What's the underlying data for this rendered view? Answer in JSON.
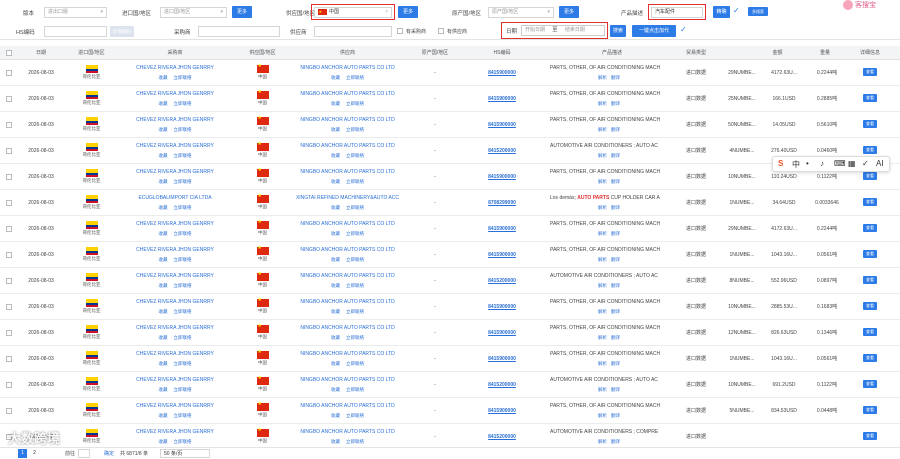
{
  "filters": {
    "version_label": "版本",
    "version_value": "进出口版",
    "import_country_label": "进口国/地区",
    "import_country_placeholder": "进口国/地区",
    "more_label": "更多",
    "supplier_country_label": "供应国/地区",
    "supplier_country_value": "中国",
    "origin_country_label": "原产国/地区",
    "origin_country_placeholder": "原产国/地区",
    "product_desc_label": "产品描述",
    "product_desc_value": "汽车配件",
    "precise_label": "精确",
    "multi_label": "多搜索",
    "hs_label": "HS编码",
    "hs_btn": "新增编码",
    "buyer_label": "采购商",
    "supplier_label": "供应商",
    "has_buyer_label": "有采购商",
    "has_supplier_label": "有供应商",
    "date_label": "日期",
    "start_date": "开始日期",
    "date_sep": "至",
    "end_date": "结束日期",
    "search_btn": "搜索",
    "search_all_btn": "一键点击加代",
    "logo_text": "客搜宝"
  },
  "columns": [
    "日期",
    "进口国/地区",
    "采购商",
    "供应国/地区",
    "供应商",
    "原产国/地区",
    "HS编码",
    "产品描述",
    "贸易类型",
    "金额",
    "重量",
    "详细信息"
  ],
  "rows": [
    {
      "date": "2026-08-03",
      "importer_country": "哥伦比亚",
      "buyer": "CHEVEZ RIVERA JHON GENRRY",
      "supplier_country": "中国",
      "supplier": "NINGBO ANCHOR AUTO PARTS CO LTD",
      "origin": "-",
      "hs": "8415900000",
      "desc": "PARTS, OTHER, OF AIR CONDITIONING MACH",
      "trade": "进口数据",
      "qty": "29NUMBE...",
      "amount": "4172.63U...",
      "weight": "0.2244吨"
    },
    {
      "date": "2026-08-03",
      "importer_country": "哥伦比亚",
      "buyer": "CHEVEZ RIVERA JHON GENRRY",
      "supplier_country": "中国",
      "supplier": "NINGBO ANCHOR AUTO PARTS CO LTD",
      "origin": "-",
      "hs": "8415900000",
      "desc": "PARTS, OTHER, OF AIR CONDITIONING MACH",
      "trade": "进口数据",
      "qty": "25NUMBE...",
      "amount": "166.1USD",
      "weight": "0.2885吨"
    },
    {
      "date": "2026-08-03",
      "importer_country": "哥伦比亚",
      "buyer": "CHEVEZ RIVERA JHON GENRRY",
      "supplier_country": "中国",
      "supplier": "NINGBO ANCHOR AUTO PARTS CO LTD",
      "origin": "-",
      "hs": "8415900000",
      "desc": "PARTS, OTHER, OF AIR CONDITIONING MACH",
      "trade": "进口数据",
      "qty": "50NUMBE...",
      "amount": "14.05USD",
      "weight": "0.5610吨"
    },
    {
      "date": "2026-08-03",
      "importer_country": "哥伦比亚",
      "buyer": "CHEVEZ RIVERA JHON GENRRY",
      "supplier_country": "中国",
      "supplier": "NINGBO ANCHOR AUTO PARTS CO LTD",
      "origin": "-",
      "hs": "8415200000",
      "desc": "AUTOMOTIVE AIR CONDITIONERS ; AUTO AC",
      "trade": "进口数据",
      "qty": "4NUMBE...",
      "amount": "276.40USD",
      "weight": "0.0460吨"
    },
    {
      "date": "2026-08-03",
      "importer_country": "哥伦比亚",
      "buyer": "CHEVEZ RIVERA JHON GENRRY",
      "supplier_country": "中国",
      "supplier": "NINGBO ANCHOR AUTO PARTS CO LTD",
      "origin": "-",
      "hs": "8415900000",
      "desc": "PARTS, OTHER, OF AIR CONDITIONING MACH",
      "trade": "进口数据",
      "qty": "10NUMBE...",
      "amount": "110.24USD",
      "weight": "0.1122吨"
    },
    {
      "date": "2026-08-03",
      "importer_country": "哥伦比亚",
      "buyer": "ECUGLOBALIMPORT CIA LTDA",
      "supplier_country": "中国",
      "supplier": "XINGTAI REFINED MACHINERY&AUTO ACC",
      "origin": "-",
      "hs": "8708299090",
      "desc_pre": "Los demás; ",
      "desc_hl": "AUTO PARTS",
      "desc_post": " CUP HOLDER CAR A",
      "trade": "进口数据",
      "qty": "1NUMBE...",
      "amount": "34.64USD",
      "weight": "0.0033646"
    },
    {
      "date": "2026-08-03",
      "importer_country": "哥伦比亚",
      "buyer": "CHEVEZ RIVERA JHON GENRRY",
      "supplier_country": "中国",
      "supplier": "NINGBO ANCHOR AUTO PARTS CO LTD",
      "origin": "-",
      "hs": "8415900000",
      "desc": "PARTS, OTHER, OF AIR CONDITIONING MACH",
      "trade": "进口数据",
      "qty": "29NUMBE...",
      "amount": "4172.63U...",
      "weight": "0.2244吨"
    },
    {
      "date": "2026-08-03",
      "importer_country": "哥伦比亚",
      "buyer": "CHEVEZ RIVERA JHON GENRRY",
      "supplier_country": "中国",
      "supplier": "NINGBO ANCHOR AUTO PARTS CO LTD",
      "origin": "-",
      "hs": "8415900000",
      "desc": "PARTS, OTHER, OF AIR CONDITIONING MACH",
      "trade": "进口数据",
      "qty": "1NUMBE...",
      "amount": "1043.16U...",
      "weight": "0.0561吨"
    },
    {
      "date": "2026-08-03",
      "importer_country": "哥伦比亚",
      "buyer": "CHEVEZ RIVERA JHON GENRRY",
      "supplier_country": "中国",
      "supplier": "NINGBO ANCHOR AUTO PARTS CO LTD",
      "origin": "-",
      "hs": "8415200000",
      "desc": "AUTOMOTIVE AIR CONDITIONERS ; AUTO AC",
      "trade": "进口数据",
      "qty": "8NUMBE...",
      "amount": "552.96USD",
      "weight": "0.0897吨"
    },
    {
      "date": "2026-08-03",
      "importer_country": "哥伦比亚",
      "buyer": "CHEVEZ RIVERA JHON GENRRY",
      "supplier_country": "中国",
      "supplier": "NINGBO ANCHOR AUTO PARTS CO LTD",
      "origin": "-",
      "hs": "8415900000",
      "desc": "PARTS, OTHER, OF AIR CONDITIONING MACH",
      "trade": "进口数据",
      "qty": "10NUMBE...",
      "amount": "2885.53U...",
      "weight": "0.1683吨"
    },
    {
      "date": "2026-08-03",
      "importer_country": "哥伦比亚",
      "buyer": "CHEVEZ RIVERA JHON GENRRY",
      "supplier_country": "中国",
      "supplier": "NINGBO ANCHOR AUTO PARTS CO LTD",
      "origin": "-",
      "hs": "8415900000",
      "desc": "PARTS, OTHER, OF AIR CONDITIONING MACH",
      "trade": "进口数据",
      "qty": "12NUMBE...",
      "amount": "826.63USD",
      "weight": "0.1346吨"
    },
    {
      "date": "2026-08-03",
      "importer_country": "哥伦比亚",
      "buyer": "CHEVEZ RIVERA JHON GENRRY",
      "supplier_country": "中国",
      "supplier": "NINGBO ANCHOR AUTO PARTS CO LTD",
      "origin": "-",
      "hs": "8415900000",
      "desc": "PARTS, OTHER, OF AIR CONDITIONING MACH",
      "trade": "进口数据",
      "qty": "1NUMBE...",
      "amount": "1043.16U...",
      "weight": "0.0561吨"
    },
    {
      "date": "2026-08-03",
      "importer_country": "哥伦比亚",
      "buyer": "CHEVEZ RIVERA JHON GENRRY",
      "supplier_country": "中国",
      "supplier": "NINGBO ANCHOR AUTO PARTS CO LTD",
      "origin": "-",
      "hs": "8415200000",
      "desc": "AUTOMOTIVE AIR CONDITIONERS ; AUTO AC",
      "trade": "进口数据",
      "qty": "10NUMBE...",
      "amount": "691.2USD",
      "weight": "0.1122吨"
    },
    {
      "date": "2026-08-03",
      "importer_country": "哥伦比亚",
      "buyer": "CHEVEZ RIVERA JHON GENRRY",
      "supplier_country": "中国",
      "supplier": "NINGBO ANCHOR AUTO PARTS CO LTD",
      "origin": "-",
      "hs": "8415900000",
      "desc": "PARTS, OTHER, OF AIR CONDITIONING MACH",
      "trade": "进口数据",
      "qty": "5NUMBE...",
      "amount": "834.53USD",
      "weight": "0.0448吨"
    },
    {
      "date": "2026-08-03",
      "importer_country": "哥伦比亚",
      "buyer": "CHEVEZ RIVERA JHON GENRRY",
      "supplier_country": "中国",
      "supplier": "NINGBO ANCHOR AUTO PARTS CO LTD",
      "origin": "-",
      "hs": "8415200000",
      "desc": "AUTOMOTIVE AIR CONDITIONERS ; COMPRE",
      "trade": "进口数据",
      "qty": "",
      "amount": "",
      "weight": ""
    }
  ],
  "row_actions": {
    "collect": "收藏",
    "contact": "立即联络",
    "analyze": "解析",
    "translate": "翻译",
    "detail": "查看"
  },
  "floatbar": [
    "S",
    "中",
    "•",
    "♪",
    "⌨",
    "▦",
    "✓",
    "AI"
  ],
  "footer": {
    "page_current": "1",
    "page_next": "2",
    "goto": "前往",
    "total": "共 6871/8 条",
    "page_size": "50 条/页",
    "confirm": "确定"
  },
  "watermark": "大数跨境",
  "colors": {
    "primary": "#2d7be6",
    "highlight_border": "#e03131",
    "link": "#2a6fd6"
  }
}
